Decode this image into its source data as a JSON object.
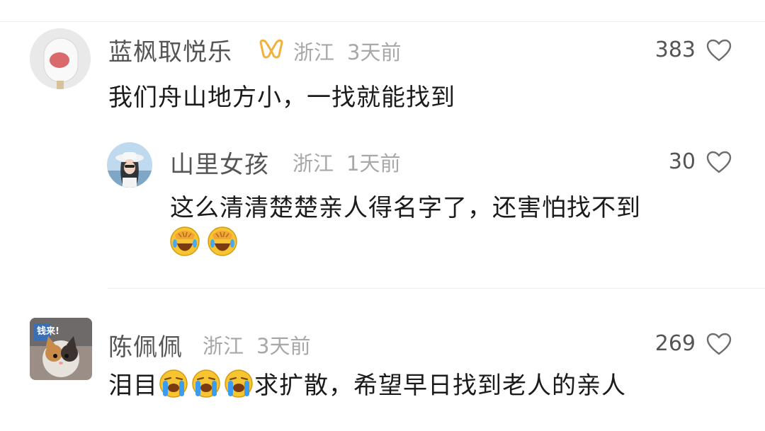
{
  "comments": [
    {
      "name": "蓝枫取悦乐",
      "location": "浙江",
      "time": "3天前",
      "likes": "383",
      "text": "我们舟山地方小，一找就能找到",
      "badge_color": "#f2b13a"
    },
    {
      "name": "山里女孩",
      "location": "浙江",
      "time": "1天前",
      "likes": "30",
      "text": "这么清清楚楚亲人得名字了，还害怕找不到",
      "emojis": [
        "facepalm-laugh-emoji",
        "facepalm-laugh-emoji"
      ]
    },
    {
      "name": "陈佩佩",
      "location": "浙江",
      "time": "3天前",
      "likes": "269",
      "text_prefix": "泪目",
      "text_suffix": "求扩散，希望早日找到老人的亲人",
      "emojis": [
        "crying-emoji",
        "crying-emoji",
        "crying-emoji"
      ],
      "avatar_caption": "钱来!"
    }
  ],
  "colors": {
    "name": "#555555",
    "meta": "#a8a8a8",
    "text": "#1b1b1b",
    "divider": "#ececec",
    "emoji_yellow": "#f7c531",
    "tear_blue": "#3b9cf0"
  }
}
